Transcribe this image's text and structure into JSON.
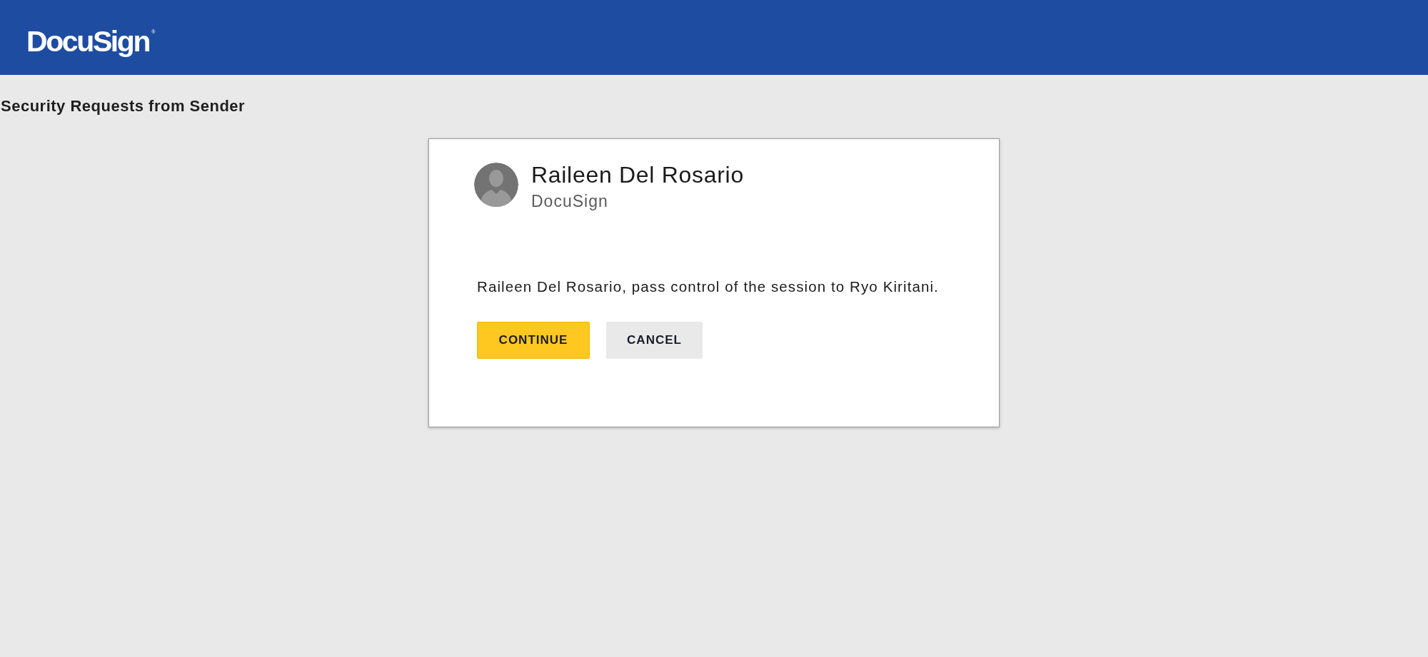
{
  "header": {
    "logo": "DocuSign$^{®}$"
  },
  "page_title": "Security Requests from Sender",
  "dialog": {
    "sender": {
      "name": "Raileen Del Rosario",
      "company": "DocuSign"
    },
    "message": "Raileen Del Rosario, pass control of the session to Ryo Kiritani.",
    "buttons": [
      {
        "label": "CONTINUE",
        "kind": "primary"
      },
      {
        "label": "CANCEL",
        "kind": "secondary"
      }
    ]
  }
}
